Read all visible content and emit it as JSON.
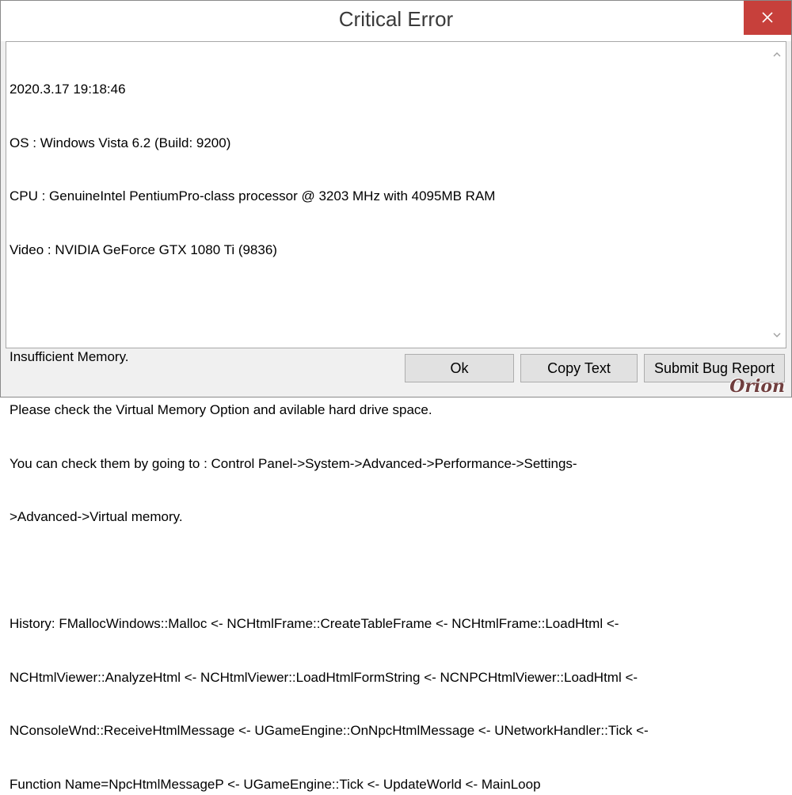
{
  "window": {
    "title": "Critical Error",
    "close_icon": "close-icon"
  },
  "message": {
    "lines": [
      "2020.3.17 19:18:46",
      "OS : Windows Vista 6.2 (Build: 9200)",
      "CPU : GenuineIntel PentiumPro-class processor @ 3203 MHz with 4095MB RAM",
      "Video : NVIDIA GeForce GTX 1080 Ti (9836)",
      "",
      "Insufficient Memory.",
      "Please check the Virtual Memory Option and avilable hard drive space.",
      "You can check them by going to : Control Panel->System->Advanced->Performance->Settings-",
      ">Advanced->Virtual memory.",
      "",
      "History: FMallocWindows::Malloc <- NCHtmlFrame::CreateTableFrame <- NCHtmlFrame::LoadHtml <-",
      "NCHtmlViewer::AnalyzeHtml <- NCHtmlViewer::LoadHtmlFormString <- NCNPCHtmlViewer::LoadHtml <-",
      "NConsoleWnd::ReceiveHtmlMessage <- UGameEngine::OnNpcHtmlMessage <- UNetworkHandler::Tick <-",
      "Function Name=NpcHtmlMessageP <- UGameEngine::Tick <- UpdateWorld <- MainLoop"
    ]
  },
  "buttons": {
    "ok": "Ok",
    "copy_text": "Copy Text",
    "submit_bug_report": "Submit Bug Report"
  },
  "watermark": {
    "text": "Orion"
  },
  "colors": {
    "close_button": "#c7403b",
    "frame_background": "#f0f0f0",
    "button_background": "#e1e1e1"
  }
}
